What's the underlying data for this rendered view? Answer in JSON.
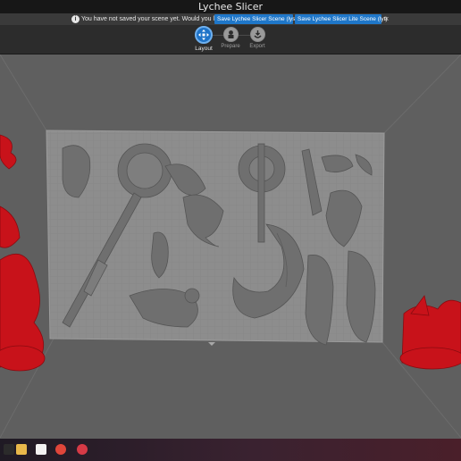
{
  "app": {
    "title": "Lychee Slicer"
  },
  "notice": {
    "message": "You have not saved your scene yet. Would you like to:",
    "save_lys": "Save Lychee Slicer Scene (lys)",
    "save_lyt": "Save Lychee Slicer Lite Scene (lyt)",
    "close": "×"
  },
  "steps": [
    {
      "label": "Layout",
      "icon": "layout-icon",
      "active": true
    },
    {
      "label": "Prepare",
      "icon": "prepare-icon",
      "active": false
    },
    {
      "label": "Export",
      "icon": "export-icon",
      "active": false
    }
  ],
  "colors": {
    "accent": "#1e73c8",
    "model": "#7a7a7a",
    "support": "#c8121a",
    "plate": "#8d8d8d"
  }
}
